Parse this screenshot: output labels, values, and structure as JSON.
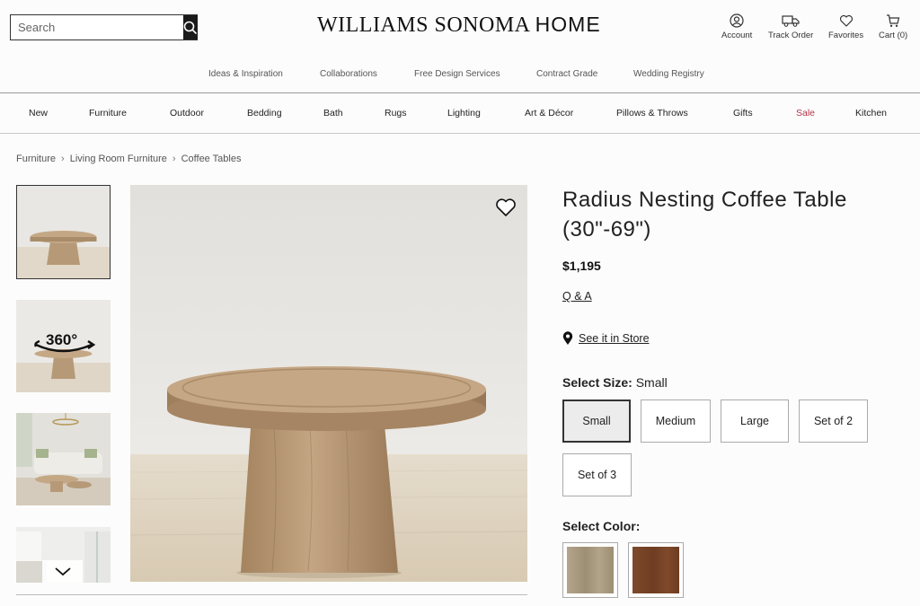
{
  "header": {
    "search_placeholder": "Search",
    "logo_main": "WILLIAMS SONOMA",
    "logo_sub": "HOME",
    "utilities": [
      {
        "label": "Account",
        "icon": "user-icon"
      },
      {
        "label": "Track Order",
        "icon": "truck-icon"
      },
      {
        "label": "Favorites",
        "icon": "heart-icon"
      },
      {
        "label": "Cart (0)",
        "icon": "cart-icon"
      }
    ]
  },
  "secondary_nav": [
    "Ideas & Inspiration",
    "Collaborations",
    "Free Design Services",
    "Contract Grade",
    "Wedding Registry"
  ],
  "main_nav": [
    "New",
    "Furniture",
    "Outdoor",
    "Bedding",
    "Bath",
    "Rugs",
    "Lighting",
    "Art & Décor",
    "Pillows & Throws",
    "Gifts",
    "Sale",
    "Kitchen"
  ],
  "breadcrumb": [
    "Furniture",
    "Living Room Furniture",
    "Coffee Tables"
  ],
  "gallery": {
    "thumb_360_label": "360°"
  },
  "product": {
    "title": "Radius Nesting Coffee Table (30\"-69\")",
    "price": "$1,195",
    "qa_link": "Q & A",
    "store_link": "See it in Store",
    "size_label": "Select Size:",
    "size_selected": "Small",
    "sizes": [
      "Small",
      "Medium",
      "Large",
      "Set of 2",
      "Set of 3"
    ],
    "color_label": "Select Color:",
    "colors": [
      "#a89a80",
      "#7a4428"
    ]
  },
  "colors": {
    "sale": "#b5364a",
    "accent": "#1a1a1a"
  }
}
